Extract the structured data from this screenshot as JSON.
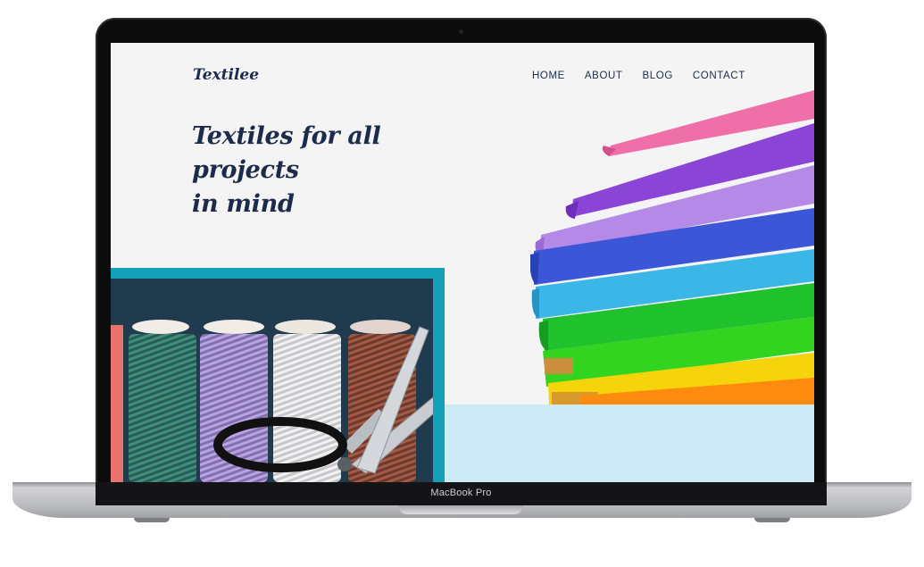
{
  "device": {
    "model_label": "MacBook Pro"
  },
  "site": {
    "logo": "Textilee",
    "nav": [
      {
        "label": "HOME"
      },
      {
        "label": "ABOUT"
      },
      {
        "label": "BLOG"
      },
      {
        "label": "CONTACT"
      }
    ],
    "hero": {
      "headline_line1": "Textiles for all projects",
      "headline_line2": "in mind"
    },
    "colors": {
      "primary_text": "#1c2a4b",
      "accent_teal": "#14a0b8",
      "navy": "#213b4e",
      "light_blue": "#cdeaf7",
      "page_bg": "#f4f4f5"
    },
    "images": [
      {
        "name": "fabric-stack-image",
        "subject": "stack of folded rainbow-colored fabrics"
      },
      {
        "name": "thread-spools-image",
        "subject": "thread spools with scissors"
      }
    ]
  }
}
